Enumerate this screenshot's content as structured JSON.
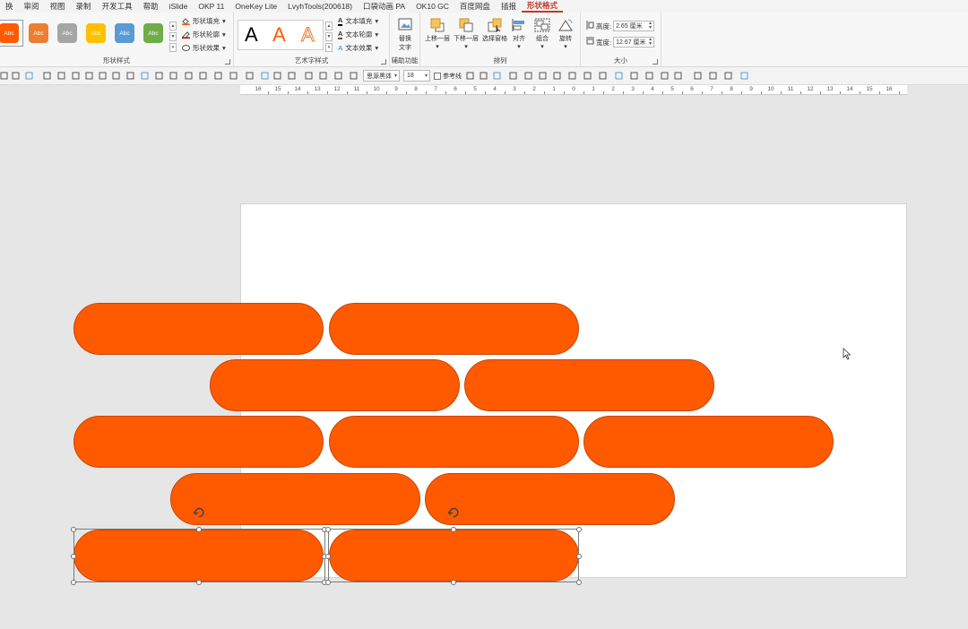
{
  "menu": {
    "items": [
      "换",
      "审阅",
      "视图",
      "录制",
      "开发工具",
      "帮助",
      "iSlide",
      "OKP 11",
      "OneKey Lite",
      "LvyhTools(200618)",
      "口袋动画 PA",
      "OK10 GC",
      "百度网盘",
      "插报",
      "形状格式"
    ],
    "active_index": 14
  },
  "ribbon": {
    "shape_styles": {
      "label": "形状样式",
      "swatch_text": "Abc",
      "swatch_colors": [
        "#ff5a00",
        "#ed7d31",
        "#a5a5a5",
        "#ffc000",
        "#5b9bd5",
        "#70ad47"
      ],
      "fill_label": "形状填充",
      "outline_label": "形状轮廓",
      "effects_label": "形状效果"
    },
    "wordart": {
      "label": "艺术字样式",
      "letter": "A",
      "text_fill_label": "文本填充",
      "text_outline_label": "文本轮廓",
      "text_effects_label": "文本效果"
    },
    "accessibility": {
      "label": "辅助功能",
      "alt_text_line1": "替换",
      "alt_text_line2": "文字"
    },
    "arrange": {
      "label": "排列",
      "bring_forward": "上移一层",
      "send_backward": "下移一层",
      "selection_pane": "选择窗格",
      "align": "对齐",
      "group": "组合",
      "rotate": "旋转"
    },
    "size": {
      "label": "大小",
      "height_label": "高度:",
      "height_value": "2.65 厘米",
      "width_label": "宽度:",
      "width_value": "12.67 厘米"
    }
  },
  "qat": {
    "font_name": "思源黑体",
    "font_size": "18",
    "guides_label": "参考线"
  },
  "ruler": {
    "labels": [
      "16",
      "15",
      "14",
      "13",
      "12",
      "11",
      "10",
      "9",
      "8",
      "7",
      "6",
      "5",
      "4",
      "3",
      "2",
      "1",
      "0",
      "1",
      "2",
      "3",
      "4",
      "5",
      "6",
      "7",
      "8",
      "9",
      "10",
      "11",
      "12",
      "13",
      "14",
      "15",
      "16"
    ]
  },
  "canvas": {
    "shape_color": "#ff5a00",
    "shape_count": 11,
    "selected_count": 2
  }
}
